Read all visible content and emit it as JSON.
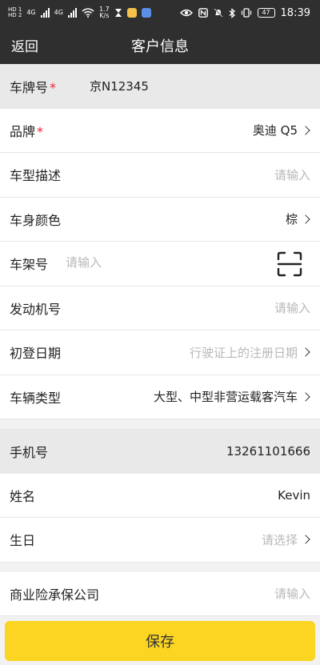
{
  "status_bar": {
    "sim1": "HD 1",
    "sim2": "HD 2",
    "net1": "4G",
    "net2": "4G",
    "speed_value": "1.7",
    "speed_unit": "K/s",
    "battery": "47",
    "time": "18:39"
  },
  "nav": {
    "back": "返回",
    "title": "客户信息"
  },
  "form": {
    "plate": {
      "label": "车牌号",
      "required": "*",
      "value": "京N12345"
    },
    "brand": {
      "label": "品牌",
      "required": "*",
      "value": "奥迪 Q5"
    },
    "model_desc": {
      "label": "车型描述",
      "placeholder": "请输入"
    },
    "body_color": {
      "label": "车身颜色",
      "value": "棕"
    },
    "vin": {
      "label": "车架号",
      "placeholder": "请输入"
    },
    "engine_no": {
      "label": "发动机号",
      "placeholder": "请输入"
    },
    "reg_date": {
      "label": "初登日期",
      "placeholder": "行驶证上的注册日期"
    },
    "vehicle_type": {
      "label": "车辆类型",
      "value": "大型、中型非营运载客汽车"
    },
    "phone": {
      "label": "手机号",
      "value": "13261101666"
    },
    "name": {
      "label": "姓名",
      "value": "Kevin"
    },
    "birthday": {
      "label": "生日",
      "placeholder": "请选择"
    },
    "insurer": {
      "label": "商业险承保公司",
      "placeholder": "请输入"
    }
  },
  "save_label": "保存",
  "colors": {
    "header_bg": "#2f2f2f",
    "accent": "#fcd522",
    "required": "#e22233",
    "placeholder": "#b8b8b8"
  },
  "icons": [
    "signal-icon",
    "wifi-icon",
    "hourglass-icon",
    "eye-icon",
    "nfc-icon",
    "mute-icon",
    "bluetooth-icon",
    "vibrate-icon",
    "battery-icon",
    "scan-icon",
    "chevron-right-icon"
  ]
}
